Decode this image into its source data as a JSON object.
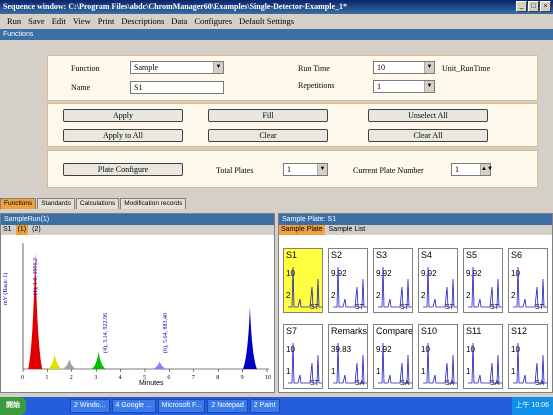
{
  "window": {
    "title": "Sequence window: C:\\Program Files\\abdc\\ChromManager60\\Examples\\Single-Detector-Example_1*"
  },
  "menu": [
    "Run",
    "Save",
    "Edit",
    "View",
    "Print",
    "Descriptions",
    "Data",
    "Configures",
    "Default Settings"
  ],
  "functions_bar": "Functions",
  "form": {
    "function_label": "Function",
    "function_value": "Sample",
    "name_label": "Name",
    "name_value": "S1",
    "runtime_label": "Run Time",
    "runtime_value": "10",
    "runtime_unit": "Unit_RunTime",
    "repetitions_label": "Repetitions",
    "repetitions_value": "1"
  },
  "buttons": {
    "apply": "Apply",
    "fill": "Fill",
    "unselect_all": "Unselect All",
    "apply_all": "Apply to All",
    "clear": "Clear",
    "clear_all": "Clear All",
    "plate_configure": "Plate Configure"
  },
  "plates": {
    "total_label": "Total Plates",
    "total_value": "1",
    "current_label": "Current Plate Number",
    "current_value": "1"
  },
  "tabs": [
    "Functions",
    "Standards",
    "Calculations",
    "Modification records"
  ],
  "left_pane": {
    "header": "SampleRun(1)",
    "subtabs": [
      "S1",
      "(1)",
      "(2)"
    ],
    "xlabel": "Minutes",
    "x_ticks": [
      "0",
      "1",
      "2",
      "3",
      "4",
      "5",
      "6",
      "7",
      "8",
      "9",
      "10"
    ],
    "ylabel": "mV (Basic 1)",
    "peak_labels": [
      "(1), 1.0, 1956.2",
      "(4), 3.14, 922.96",
      "(6), 5.64, 883.40"
    ]
  },
  "right_pane": {
    "header": "Sample Plate: S1",
    "subtabs": [
      "Sample Plate",
      "Sample List"
    ],
    "thumbs": [
      {
        "t": "S1",
        "a": "10",
        "b": "2",
        "c": "ST"
      },
      {
        "t": "S2",
        "a": "9.92",
        "b": "2",
        "c": "ST"
      },
      {
        "t": "S3",
        "a": "9.92",
        "b": "2",
        "c": "ST"
      },
      {
        "t": "S4",
        "a": "9.92",
        "b": "2",
        "c": "ST"
      },
      {
        "t": "S5",
        "a": "9.92",
        "b": "2",
        "c": "ST"
      },
      {
        "t": "S6",
        "a": "10",
        "b": "2",
        "c": "ST"
      },
      {
        "t": "S7",
        "a": "10",
        "b": "1",
        "c": "ST"
      },
      {
        "t": "Remarks",
        "a": "39.83",
        "b": "1",
        "c": "SA"
      },
      {
        "t": "Compared",
        "a": "9.92",
        "b": "1",
        "c": "SA"
      },
      {
        "t": "S10",
        "a": "10",
        "b": "1",
        "c": "SA"
      },
      {
        "t": "S11",
        "a": "10",
        "b": "1",
        "c": "SA"
      },
      {
        "t": "S12",
        "a": "10",
        "b": "1",
        "c": "SA"
      }
    ]
  },
  "taskbar": {
    "start": "開始",
    "tasks": [
      "2 Windo...",
      "4 Google ...",
      "Microsoft F...",
      "2 Notepad",
      "2 Paint"
    ],
    "clock": "上午 10:06"
  },
  "chart_data": {
    "type": "line",
    "xlabel": "Minutes",
    "xlim": [
      0,
      10
    ],
    "peaks": [
      {
        "rt": 0.5,
        "height": 0.95,
        "color": "#e00000"
      },
      {
        "rt": 1.3,
        "height": 0.12,
        "color": "#e0e000"
      },
      {
        "rt": 1.9,
        "height": 0.08,
        "color": "#a0a0a0"
      },
      {
        "rt": 3.1,
        "height": 0.14,
        "color": "#00c000"
      },
      {
        "rt": 5.6,
        "height": 0.06,
        "color": "#8080ff"
      },
      {
        "rt": 9.3,
        "height": 0.5,
        "color": "#0000c0"
      }
    ]
  }
}
